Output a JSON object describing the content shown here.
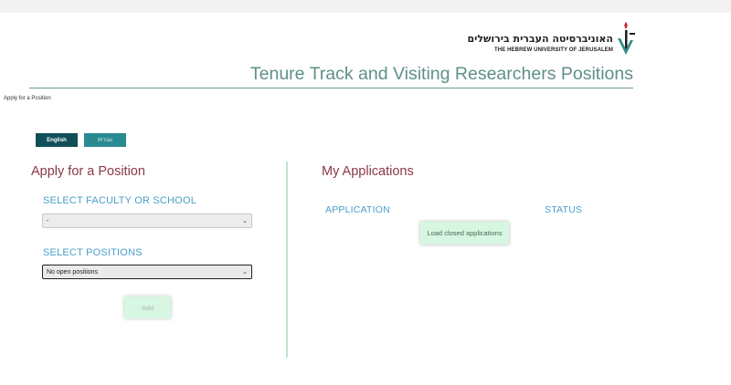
{
  "header": {
    "logo_hebrew": "האוניברסיטה העברית בירושלים",
    "logo_english": "THE HEBREW UNIVERSITY OF JERUSALEM",
    "site_title": "Tenure Track and Visiting Researchers Positions",
    "accent_color": "#6c9d98"
  },
  "breadcrumb": "Apply for a Position",
  "language": {
    "english_label": "English",
    "hebrew_label": "עברית"
  },
  "apply_panel": {
    "heading": "Apply for a Position",
    "faculty_label": "SELECT FACULTY OR SCHOOL",
    "faculty_value": "-",
    "positions_label": "SELECT POSITIONS",
    "positions_value": "No open positions",
    "add_label": "Add"
  },
  "applications_panel": {
    "heading": "My Applications",
    "col_application": "APPLICATION",
    "col_status": "STATUS",
    "load_closed_label": "Load closed applications"
  },
  "colors": {
    "heading": "#8a3747",
    "label": "#4aa0c8",
    "button_green": "#d7f7e2",
    "lang_english": "#114f58",
    "lang_hebrew": "#2a8a92"
  }
}
